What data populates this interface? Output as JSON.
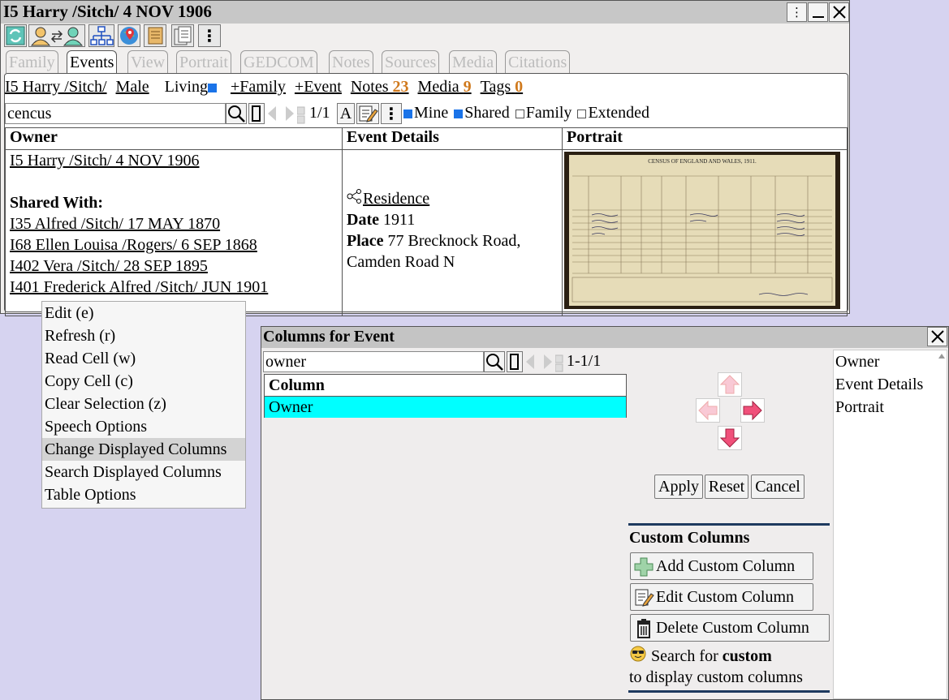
{
  "window": {
    "title": "I5 Harry /Sitch/ 4 NOV 1906",
    "title_buttons": [
      "⋮",
      "—",
      "✕"
    ]
  },
  "tabs": [
    "Family",
    "Events",
    "View",
    "Portrait",
    "GEDCOM",
    "Notes",
    "Sources",
    "Media",
    "Citations"
  ],
  "active_tab": "Events",
  "person_bar": {
    "id_name": "I5 Harry /Sitch/",
    "gender": "Male",
    "living_label": "Living",
    "add_family": "+Family",
    "add_event": "+Event",
    "notes_label": "Notes",
    "notes_count": "23",
    "media_label": "Media",
    "media_count": "9",
    "tags_label": "Tags",
    "tags_count": "0"
  },
  "search": {
    "value": "cencus",
    "page": "1/1",
    "font_btn": "A",
    "filters": [
      {
        "label": "Mine",
        "checked": true
      },
      {
        "label": "Shared",
        "checked": true
      },
      {
        "label": "Family",
        "checked": false
      },
      {
        "label": "Extended",
        "checked": false
      }
    ]
  },
  "table": {
    "headers": [
      "Owner",
      "Event Details",
      "Portrait"
    ],
    "owner": "I5 Harry /Sitch/ 4 NOV 1906",
    "shared_with_label": "Shared With:",
    "shared_with": [
      "I35 Alfred /Sitch/ 17 MAY 1870",
      "I68 Ellen Louisa /Rogers/ 6 SEP 1868",
      "I402 Vera /Sitch/ 28 SEP 1895",
      "I401 Frederick Alfred /Sitch/ JUN 1901"
    ],
    "event_type": "Residence",
    "date_label": "Date",
    "date_value": "1911",
    "place_label": "Place",
    "place_value": "77 Brecknock Road, Camden Road N",
    "portrait_caption": "CENSUS OF ENGLAND AND WALES, 1911."
  },
  "context_menu": [
    "Edit (e)",
    "Refresh (r)",
    "Read Cell (w)",
    "Copy Cell (c)",
    "Clear Selection (z)",
    "Speech Options",
    "Change Displayed Columns",
    "Search Displayed Columns",
    "Table Options"
  ],
  "context_menu_highlight": "Change Displayed Columns",
  "columns_dialog": {
    "title": "Columns for Event",
    "search_value": "owner",
    "page": "1-1/1",
    "column_header": "Column",
    "rows": [
      "Owner"
    ],
    "selected_row": "Owner",
    "displayed": [
      "Owner",
      "Event Details",
      "Portrait"
    ],
    "apply": "Apply",
    "reset": "Reset",
    "cancel": "Cancel",
    "custom_title": "Custom Columns",
    "add_custom": "Add Custom Column",
    "edit_custom": "Edit Custom Column",
    "delete_custom": "Delete Custom Column",
    "hint_prefix": "Search for",
    "hint_bold": "custom",
    "hint_suffix": "to display custom columns",
    "close": "✕"
  },
  "colors": {
    "background": "#d6d3f0",
    "selected_row": "#00ffff",
    "accent_orange": "#d07a1e",
    "arrow_pink": "#f0507a",
    "divider_blue": "#1e3a5f"
  }
}
